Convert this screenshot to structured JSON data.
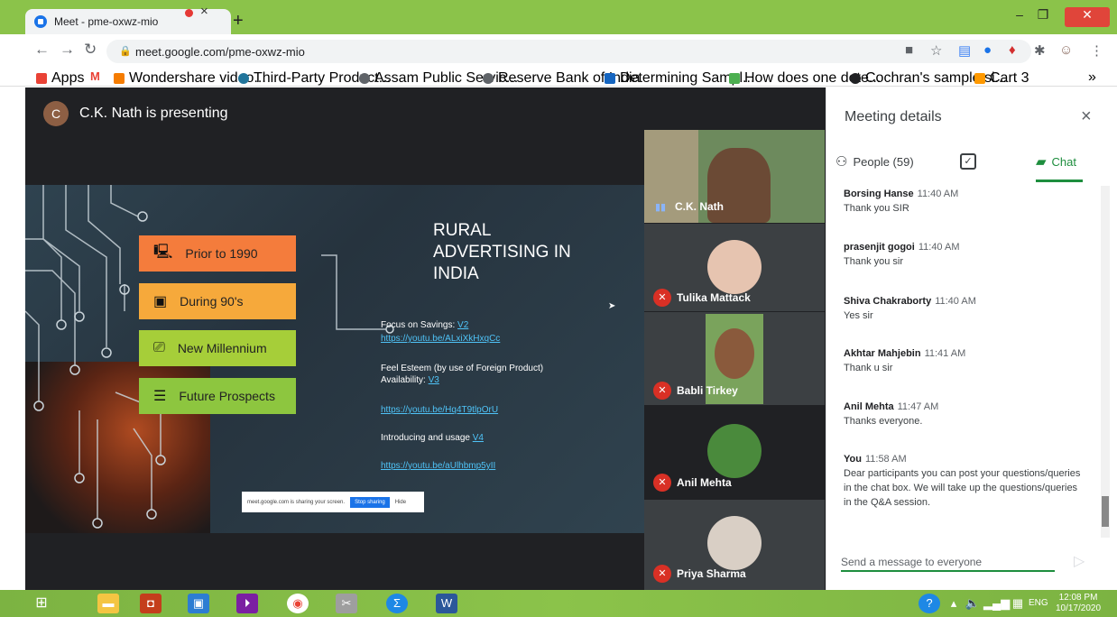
{
  "browser": {
    "tab_title": "Meet - pme-oxwz-mio",
    "tab_close": "×",
    "new_tab": "+",
    "url": "meet.google.com/pme-oxwz-mio",
    "bookmarks_overflow": "»",
    "bookmarks": [
      {
        "label": "Apps",
        "icon_color": "#e94235"
      },
      {
        "label": "M",
        "icon_color": "#ffffff"
      },
      {
        "label": "Wondershare video...",
        "icon_color": "#f57c00"
      },
      {
        "label": "Third-Party Product...",
        "icon_color": "#21759b"
      },
      {
        "label": "Assam Public Servic...",
        "icon_color": "#5f6368"
      },
      {
        "label": "Reserve Bank of India",
        "icon_color": "#5f6368"
      },
      {
        "label": "Determining Sampl...",
        "icon_color": "#1565c0"
      },
      {
        "label": "How does one dete...",
        "icon_color": "#4caf50"
      },
      {
        "label": "Cochran's sample si...",
        "icon_color": "#202124"
      },
      {
        "label": "Cart 3",
        "icon_color": "#ff9900"
      }
    ]
  },
  "meet": {
    "presenter_initial": "C",
    "presenter_text": "C.K. Nath is presenting",
    "slide": {
      "boxes": [
        {
          "label": "Prior to 1990",
          "color": "#f47c3c"
        },
        {
          "label": "During 90's",
          "color": "#f6a93b"
        },
        {
          "label": "New Millennium",
          "color": "#a6ce39"
        },
        {
          "label": "Future Prospects",
          "color": "#8dc63f"
        }
      ],
      "title_lines": [
        "RURAL",
        "ADVERTISING IN",
        "INDIA"
      ],
      "focus_text": "Focus on Savings: ",
      "focus_v": "V2",
      "link1": "https://youtu.be/ALxiXkHxqCc",
      "esteem_line1": "Feel Esteem (by use of Foreign Product)",
      "esteem_line2": "Availability: ",
      "esteem_v": "V3",
      "link2": "https://youtu.be/Hq4T9tlpOrU",
      "intro_text": "Introducing and usage  ",
      "intro_v": "V4",
      "link3": "https://youtu.be/aUlhbmp5yII",
      "share_text": "meet.google.com is sharing your screen.",
      "share_stop": "Stop sharing",
      "share_hide": "Hide"
    },
    "participants": [
      {
        "name": "C.K. Nath",
        "muted": false
      },
      {
        "name": "Tulika Mattack",
        "muted": true
      },
      {
        "name": "Babli Tirkey",
        "muted": true
      },
      {
        "name": "Anil Mehta",
        "muted": true
      },
      {
        "name": "Priya Sharma",
        "muted": true
      }
    ]
  },
  "panel": {
    "title": "Meeting details",
    "close": "×",
    "people_tab": "People (59)",
    "chat_tab": "Chat",
    "messages": [
      {
        "sender": "Borsing Hanse",
        "time": "11:40 AM",
        "text": "Thank you SIR"
      },
      {
        "sender": "prasenjit gogoi",
        "time": "11:40 AM",
        "text": "Thank you sir"
      },
      {
        "sender": "Shiva Chakraborty",
        "time": "11:40 AM",
        "text": "Yes sir"
      },
      {
        "sender": "Akhtar Mahjebin",
        "time": "11:41 AM",
        "text": "Thank u sir"
      },
      {
        "sender": "Anil Mehta",
        "time": "11:47 AM",
        "text": "Thanks everyone."
      },
      {
        "sender": "You",
        "time": "11:58 AM",
        "text": "Dear participants you can post your questions/queries in the chat box. We will take up the questions/queries in the Q&A session."
      }
    ],
    "input_placeholder": "Send a message to everyone"
  },
  "taskbar": {
    "lang": "ENG",
    "time": "12:08 PM",
    "date": "10/17/2020"
  }
}
